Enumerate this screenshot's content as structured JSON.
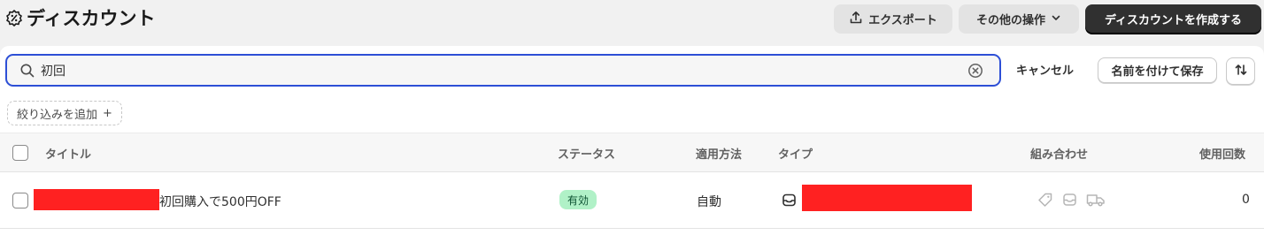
{
  "header": {
    "title": "ディスカウント",
    "export_label": "エクスポート",
    "more_actions_label": "その他の操作",
    "create_label": "ディスカウントを作成する"
  },
  "search": {
    "value": "初回",
    "cancel_label": "キャンセル",
    "save_as_label": "名前を付けて保存"
  },
  "filters": {
    "add_label": "絞り込みを追加",
    "add_symbol": "+"
  },
  "table": {
    "columns": {
      "title": "タイトル",
      "status": "ステータス",
      "method": "適用方法",
      "type": "タイプ",
      "combinations": "組み合わせ",
      "usage": "使用回数"
    },
    "rows": [
      {
        "title": "初回購入で500円OFF",
        "status": "有効",
        "method": "自動",
        "usage": "0"
      }
    ]
  },
  "colors": {
    "accent_focus": "#2d4fd6",
    "status_active_bg": "#b0f1c7",
    "primary_button": "#303030",
    "redaction": "#ff2121"
  }
}
